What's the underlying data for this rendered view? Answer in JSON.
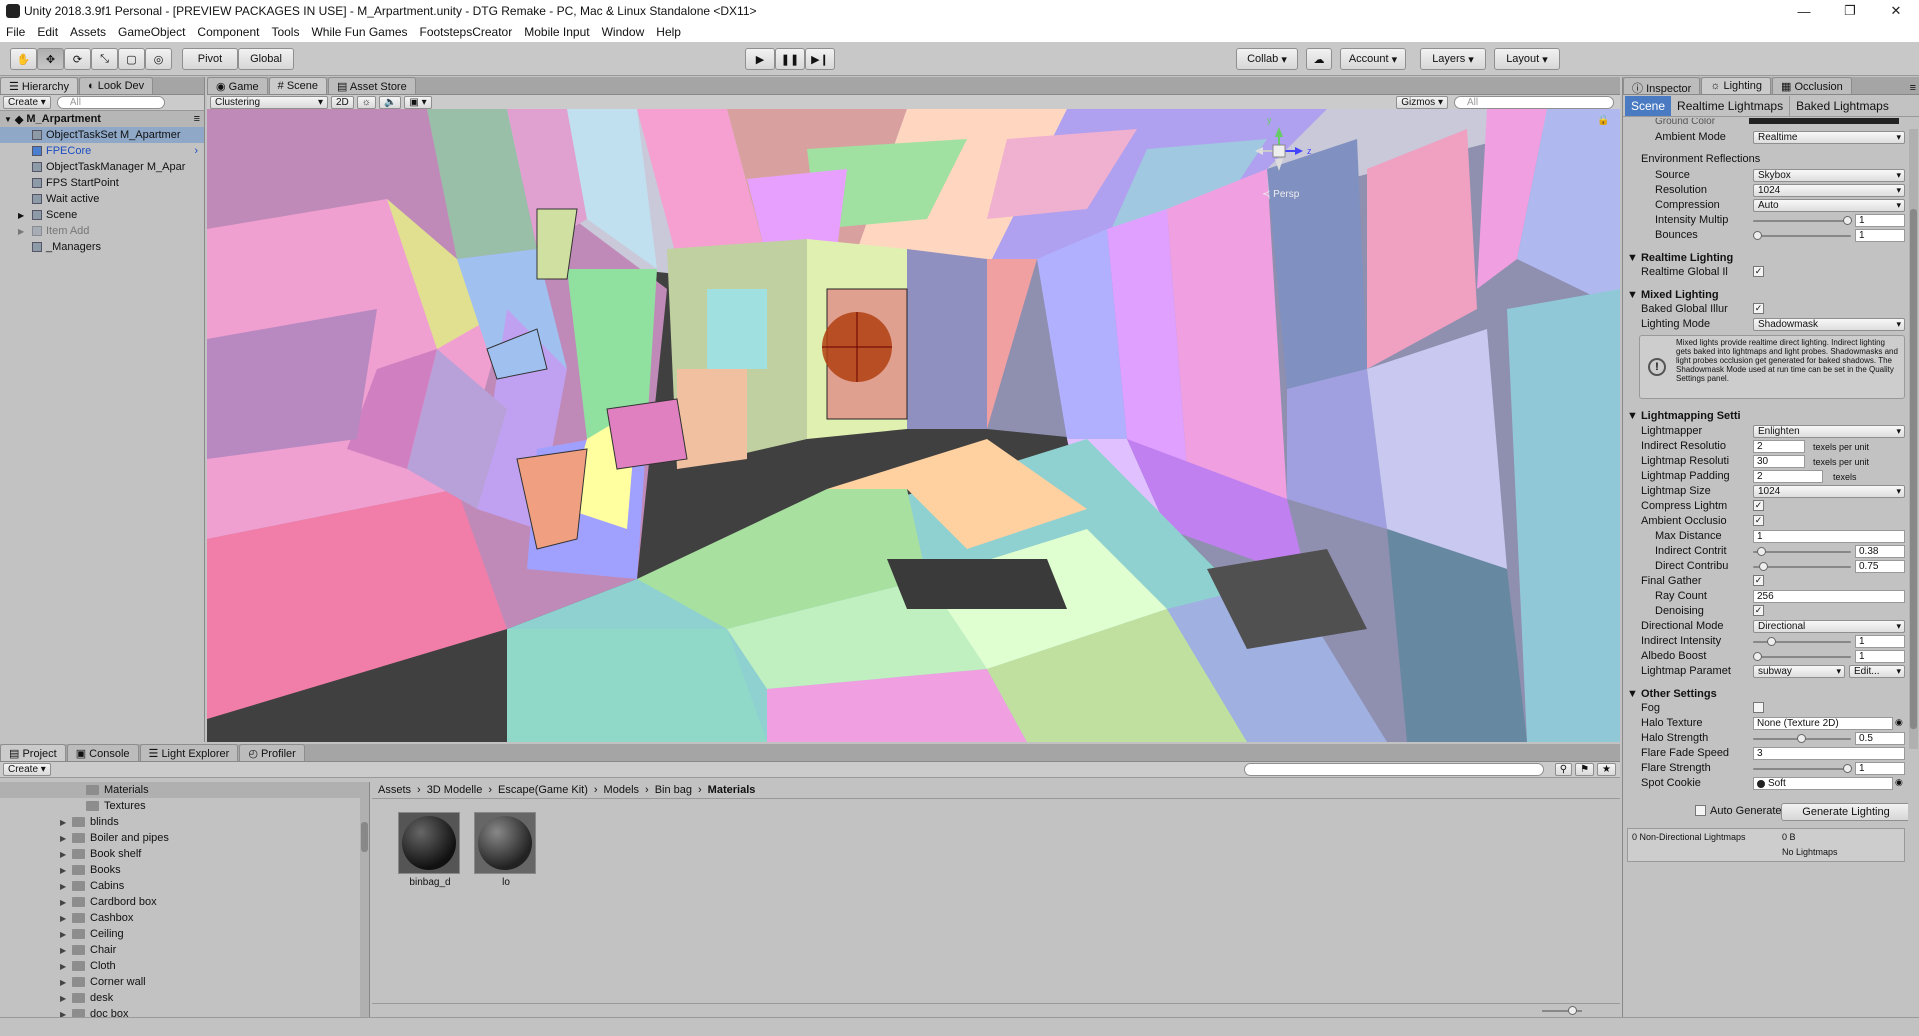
{
  "window": {
    "title": "Unity 2018.3.9f1 Personal - [PREVIEW PACKAGES IN USE] - M_Arpartment.unity - DTG Remake - PC, Mac & Linux Standalone <DX11>",
    "minimize": "—",
    "maximize": "❐",
    "close": "✕"
  },
  "menu": [
    "File",
    "Edit",
    "Assets",
    "GameObject",
    "Component",
    "Tools",
    "While Fun Games",
    "FootstepsCreator",
    "Mobile Input",
    "Window",
    "Help"
  ],
  "toolbar": {
    "pivot": "Pivot",
    "global": "Global",
    "collab": "Collab",
    "account": "Account",
    "layers": "Layers",
    "layout": "Layout"
  },
  "hierarchy": {
    "tabs": [
      "Hierarchy",
      "Look Dev"
    ],
    "create": "Create",
    "search_placeholder": "All",
    "scene": "M_Arpartment",
    "items": [
      {
        "label": "ObjectTaskSet M_Apartmer",
        "selected": true
      },
      {
        "label": "FPECore",
        "blue": true
      },
      {
        "label": "ObjectTaskManager M_Apar"
      },
      {
        "label": "FPS StartPoint"
      },
      {
        "label": "Wait active"
      },
      {
        "label": "Scene",
        "expand": true
      },
      {
        "label": "Item Add",
        "expand": true,
        "dim": true
      },
      {
        "label": "_Managers"
      }
    ]
  },
  "scene": {
    "tabs": [
      "Game",
      "Scene",
      "Asset Store"
    ],
    "shading": "Clustering",
    "mode2d": "2D",
    "gizmos": "Gizmos",
    "search_placeholder": "All",
    "persp": "Persp",
    "axis_y": "y",
    "axis_z": "z"
  },
  "inspector": {
    "tabs": [
      "Inspector",
      "Lighting",
      "Occlusion"
    ],
    "subtabs": [
      "Scene",
      "Realtime Lightmaps",
      "Baked Lightmaps"
    ],
    "ground_color": "Ground Color",
    "ambient_mode": {
      "label": "Ambient Mode",
      "value": "Realtime"
    },
    "env_reflections": "Environment Reflections",
    "source": {
      "label": "Source",
      "value": "Skybox"
    },
    "resolution": {
      "label": "Resolution",
      "value": "1024"
    },
    "compression": {
      "label": "Compression",
      "value": "Auto"
    },
    "intensity_multiplier": {
      "label": "Intensity Multip",
      "value": "1"
    },
    "bounces": {
      "label": "Bounces",
      "value": "1"
    },
    "realtime_lighting": "Realtime Lighting",
    "realtime_gi": "Realtime Global Il",
    "mixed_lighting": "Mixed Lighting",
    "baked_gi": "Baked Global Illur",
    "lighting_mode": {
      "label": "Lighting Mode",
      "value": "Shadowmask"
    },
    "info_text": "Mixed lights provide realtime direct lighting. Indirect lighting gets baked into lightmaps and light probes. Shadowmasks and light probes occlusion get generated for baked shadows. The Shadowmask Mode used at run time can be set in the Quality Settings panel.",
    "lightmapping": "Lightmapping Setti",
    "lightmapper": {
      "label": "Lightmapper",
      "value": "Enlighten"
    },
    "indirect_resolution": {
      "label": "Indirect Resolutio",
      "value": "2",
      "unit": "texels per unit"
    },
    "lightmap_resolution": {
      "label": "Lightmap Resoluti",
      "value": "30",
      "unit": "texels per unit"
    },
    "lightmap_padding": {
      "label": "Lightmap Padding",
      "value": "2",
      "unit": "texels"
    },
    "lightmap_size": {
      "label": "Lightmap Size",
      "value": "1024"
    },
    "compress": "Compress Lightm",
    "ambient_occlusion": "Ambient Occlusio",
    "max_distance": {
      "label": "Max Distance",
      "value": "1"
    },
    "indirect_contribution": {
      "label": "Indirect Contrit",
      "value": "0.38"
    },
    "direct_contribution": {
      "label": "Direct Contribu",
      "value": "0.75"
    },
    "final_gather": "Final Gather",
    "ray_count": {
      "label": "Ray Count",
      "value": "256"
    },
    "denoising": "Denoising",
    "directional_mode": {
      "label": "Directional Mode",
      "value": "Directional"
    },
    "indirect_intensity": {
      "label": "Indirect Intensity",
      "value": "1"
    },
    "albedo_boost": {
      "label": "Albedo Boost",
      "value": "1"
    },
    "lightmap_params": {
      "label": "Lightmap Paramet",
      "value": "subway",
      "edit": "Edit..."
    },
    "other_settings": "Other Settings",
    "fog": "Fog",
    "halo_texture": {
      "label": "Halo Texture",
      "value": "None (Texture 2D)"
    },
    "halo_strength": {
      "label": "Halo Strength",
      "value": "0.5"
    },
    "flare_fade_speed": {
      "label": "Flare Fade Speed",
      "value": "3"
    },
    "flare_strength": {
      "label": "Flare Strength",
      "value": "1"
    },
    "spot_cookie": {
      "label": "Spot Cookie",
      "value": "Soft"
    },
    "auto_generate": "Auto Generate",
    "generate_lighting": "Generate Lighting",
    "lightmaps_count": "0 Non-Directional Lightmaps",
    "lightmaps_size": "0 B",
    "no_lightmaps": "No Lightmaps"
  },
  "project": {
    "tabs": [
      "Project",
      "Console",
      "Light Explorer",
      "Profiler"
    ],
    "create": "Create",
    "tree": [
      {
        "label": "Materials",
        "selected": true,
        "indent": 1
      },
      {
        "label": "Textures",
        "indent": 1
      },
      {
        "label": "blinds"
      },
      {
        "label": "Boiler and pipes"
      },
      {
        "label": "Book shelf"
      },
      {
        "label": "Books"
      },
      {
        "label": "Cabins"
      },
      {
        "label": "Cardbord box"
      },
      {
        "label": "Cashbox"
      },
      {
        "label": "Ceiling"
      },
      {
        "label": "Chair"
      },
      {
        "label": "Cloth"
      },
      {
        "label": "Corner wall"
      },
      {
        "label": "desk"
      },
      {
        "label": "doc box"
      }
    ],
    "breadcrumb": [
      "Assets",
      "3D Modelle",
      "Escape(Game Kit)",
      "Models",
      "Bin bag",
      "Materials"
    ],
    "assets": [
      {
        "label": "binbag_d"
      },
      {
        "label": "lo"
      }
    ]
  }
}
